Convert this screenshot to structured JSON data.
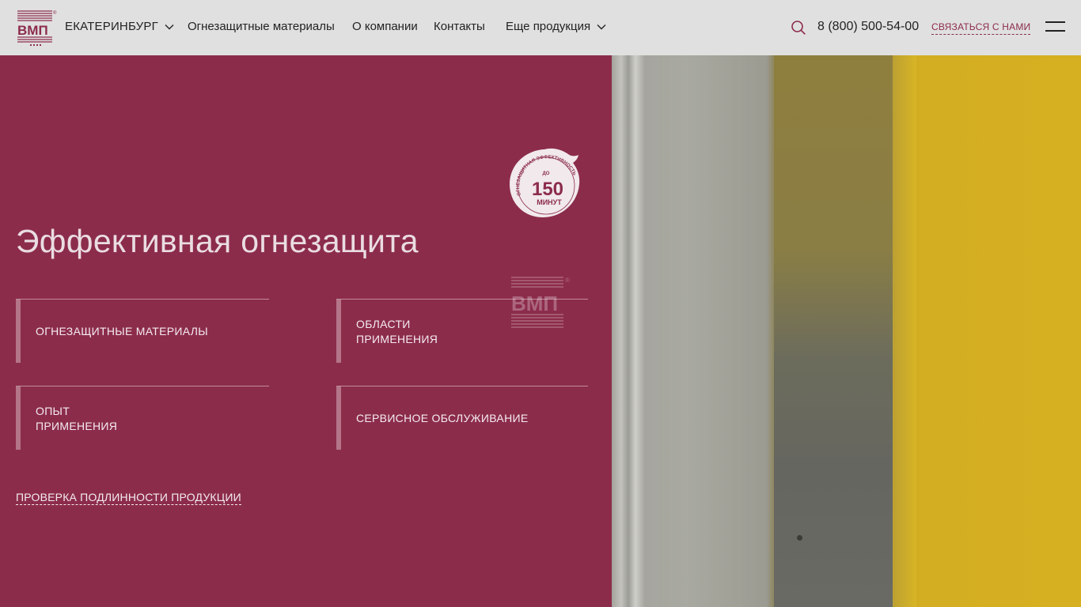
{
  "header": {
    "city": "ЕКАТЕРИНБУРГ",
    "nav": [
      {
        "label": "Огнезащитные материалы"
      },
      {
        "label": "О компании"
      },
      {
        "label": "Контакты"
      },
      {
        "label": "Еще продукция"
      }
    ],
    "phone": "8 (800) 500-54-00",
    "contact_label": "СВЯЗАТЬСЯ С НАМИ"
  },
  "logo": {
    "text": "ВМП",
    "registered": "®"
  },
  "hero": {
    "title": "Эффективная огнезащита",
    "badge": {
      "arc_text": "ОГНЕЗАЩИТНАЯ ЭФФЕКТИВНОСТЬ",
      "prefix": "ДО",
      "value": "150",
      "unit": "МИНУТ"
    },
    "cards": [
      {
        "label": "ОГНЕЗАЩИТНЫЕ МАТЕРИАЛЫ"
      },
      {
        "label": "ОБЛАСТИ\nПРИМЕНЕНИЯ"
      },
      {
        "label": "ОПЫТ\nПРИМЕНЕНИЯ"
      },
      {
        "label": "СЕРВИСНОЕ ОБСЛУЖИВАНИЕ"
      }
    ],
    "verify_link": "ПРОВЕРКА ПОДЛИННОСТИ ПРОДУКЦИИ"
  },
  "colors": {
    "brand": "#8c2c4b",
    "header_bg": "#e0e0e0"
  },
  "icons": [
    "logo-icon",
    "chevron-down-icon",
    "search-icon",
    "menu-icon",
    "badge-icon"
  ]
}
